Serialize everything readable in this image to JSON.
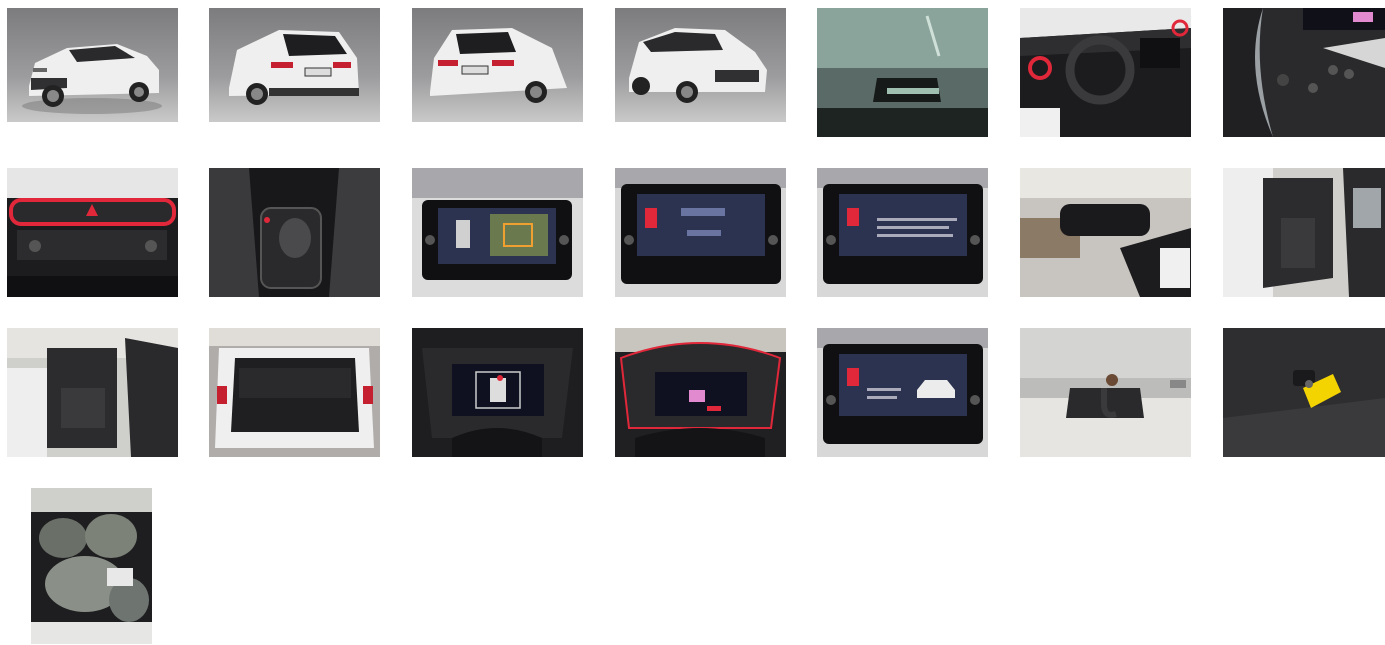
{
  "gallery": {
    "photos": [
      {
        "subject": "car-front-three-quarter",
        "row": 0,
        "col": 0
      },
      {
        "subject": "car-rear-three-quarter-left",
        "row": 0,
        "col": 1
      },
      {
        "subject": "car-rear-three-quarter-right",
        "row": 0,
        "col": 2
      },
      {
        "subject": "car-front-three-quarter-right",
        "row": 0,
        "col": 3
      },
      {
        "subject": "windshield-vin-plate",
        "row": 0,
        "col": 4
      },
      {
        "subject": "dashboard-steering",
        "row": 0,
        "col": 5
      },
      {
        "subject": "steering-wheel-buttons",
        "row": 0,
        "col": 6
      },
      {
        "subject": "climate-controls",
        "row": 1,
        "col": 0
      },
      {
        "subject": "gear-selector",
        "row": 1,
        "col": 1
      },
      {
        "subject": "infotainment-camera",
        "row": 1,
        "col": 2
      },
      {
        "subject": "infotainment-bluetooth",
        "row": 1,
        "col": 3
      },
      {
        "subject": "infotainment-mobile",
        "row": 1,
        "col": 4
      },
      {
        "subject": "rearview-mirror",
        "row": 1,
        "col": 5
      },
      {
        "subject": "front-door-open",
        "row": 1,
        "col": 6
      },
      {
        "subject": "rear-door-open",
        "row": 2,
        "col": 0
      },
      {
        "subject": "trunk-open",
        "row": 2,
        "col": 1
      },
      {
        "subject": "digital-cluster-car",
        "row": 2,
        "col": 2
      },
      {
        "subject": "digital-cluster-speed",
        "row": 2,
        "col": 3
      },
      {
        "subject": "infotainment-vehicle",
        "row": 2,
        "col": 4
      },
      {
        "subject": "tow-hitch",
        "row": 2,
        "col": 5
      },
      {
        "subject": "key-with-tag",
        "row": 2,
        "col": 6
      },
      {
        "subject": "tires-in-trunk",
        "row": 3,
        "col": 0
      }
    ]
  },
  "colors": {
    "studio_bg": "#8a8a8a",
    "car_white": "#eeeeee",
    "accent_red": "#e0283a",
    "interior_dark": "#1b1b1d",
    "screen_blue": "#2c3350",
    "tag_yellow": "#f4d400"
  }
}
